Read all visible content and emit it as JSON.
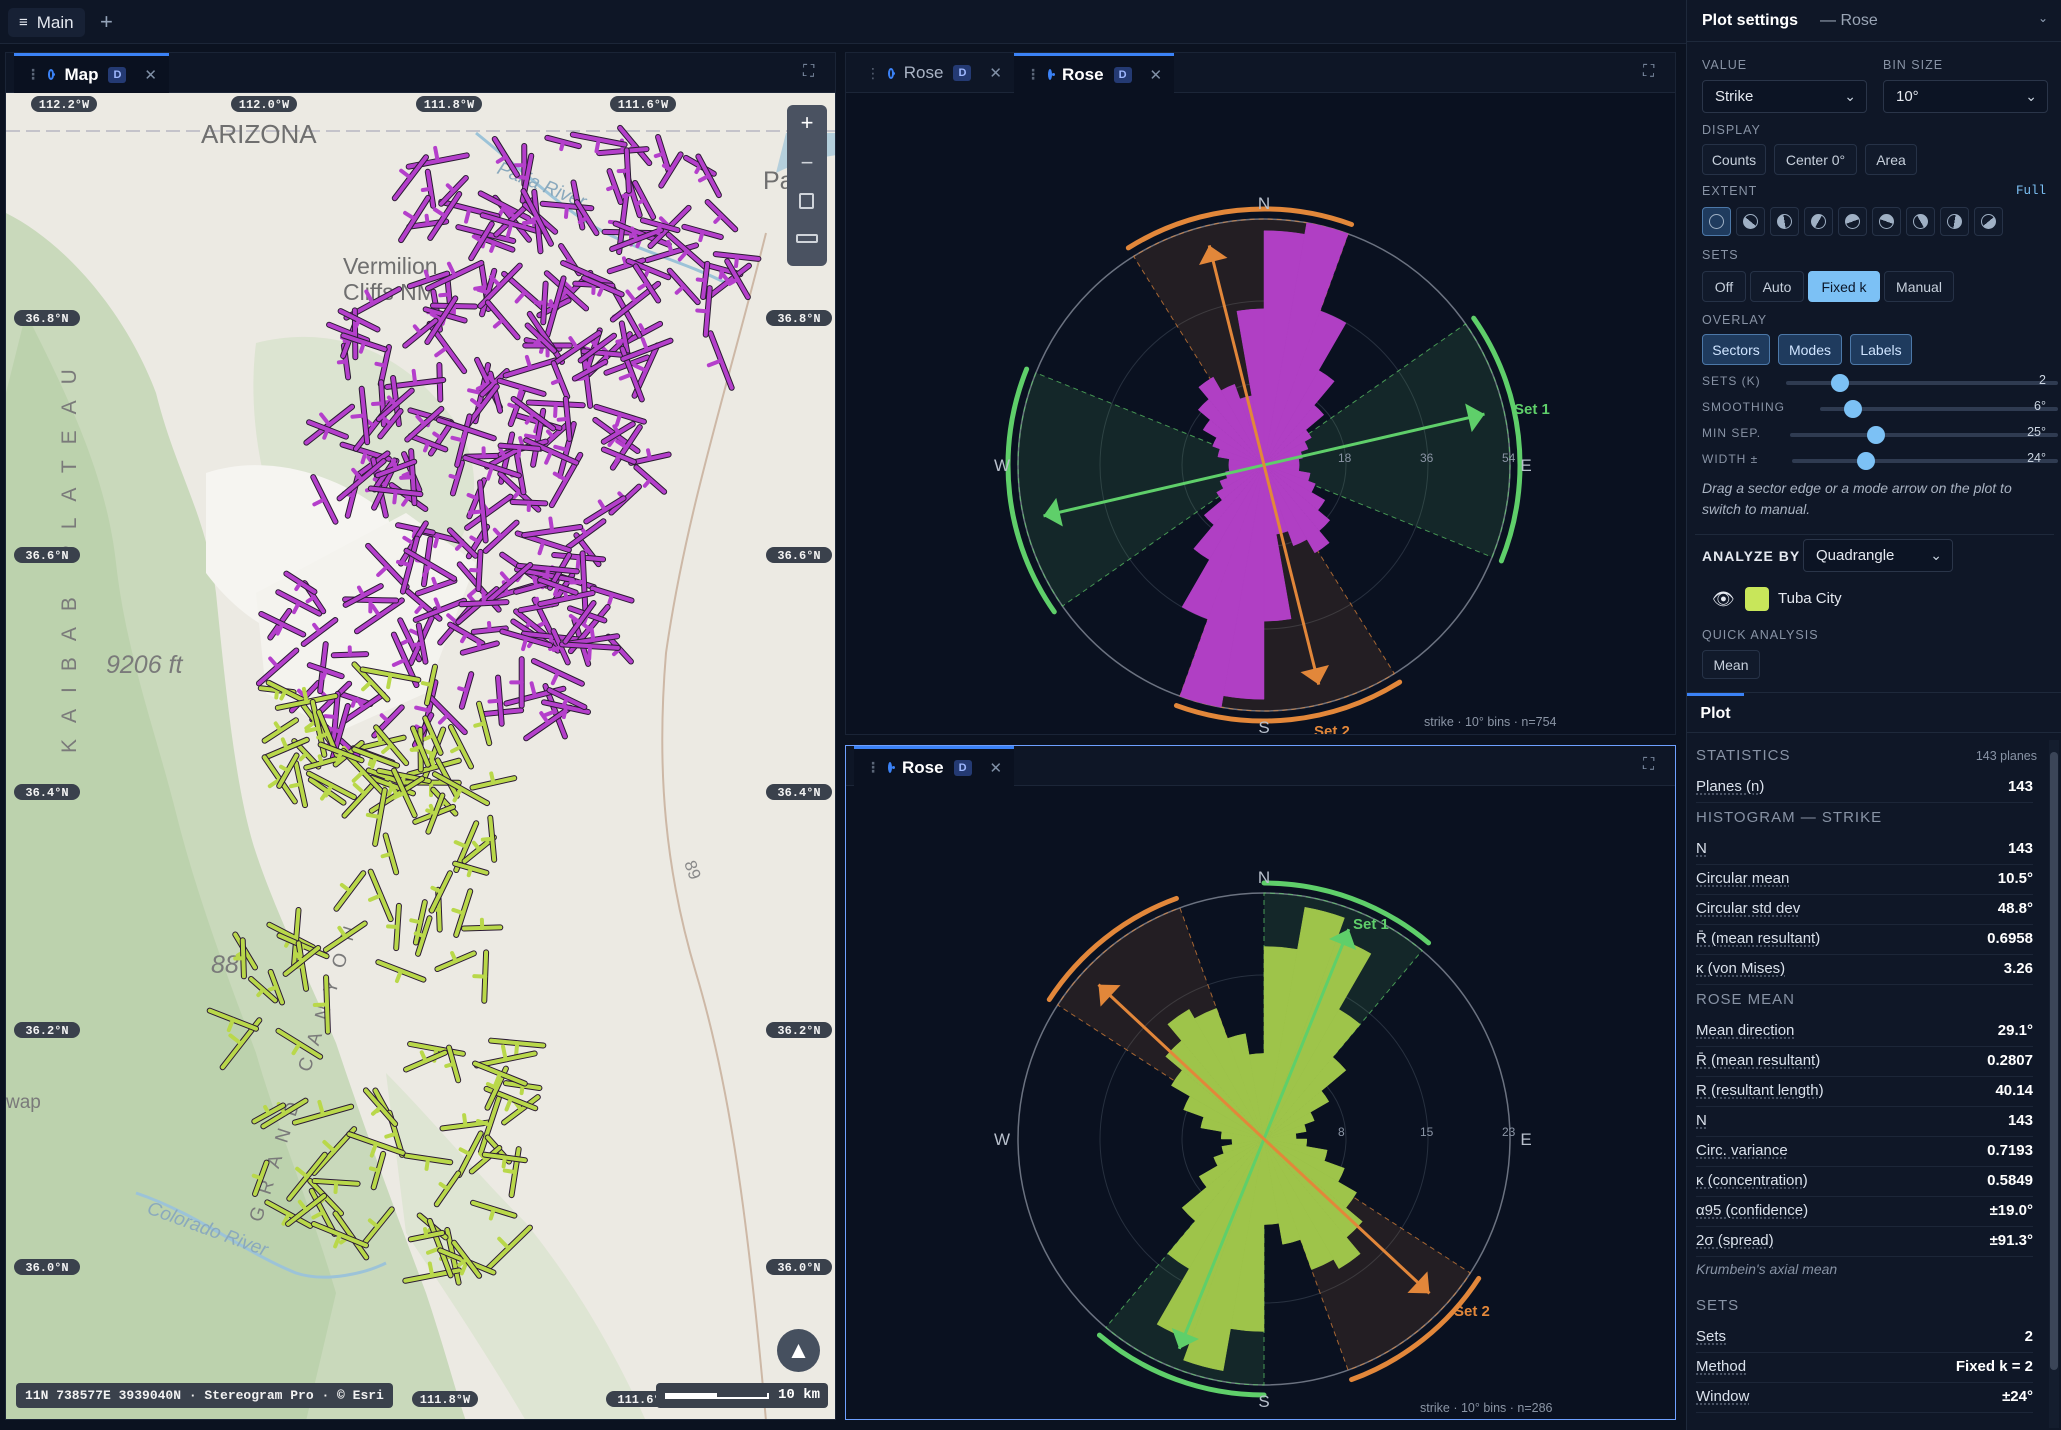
{
  "topbar": {
    "main_tab": "Main",
    "add": "+"
  },
  "map_panel": {
    "tab_label": "Map",
    "badge": "D",
    "state_label": "ARIZONA",
    "monument": [
      "Vermilion",
      "Cliffs NM"
    ],
    "river": "Paria River",
    "colorado": "Colorado River",
    "plateau": "KAIBAB PLATEAU",
    "canyon": "GRAND CANYON",
    "elevation": "9206 ft",
    "elev2": "88",
    "highway": "89",
    "edge_text": "Page",
    "edge_text2": "wap",
    "lon_top": [
      "112.2°W",
      "112.0°W",
      "111.8°W",
      "111.6°W"
    ],
    "lon_bottom": [
      "111.8°W",
      "111.6°"
    ],
    "lat_left": [
      "36.8°N",
      "36.6°N",
      "36.4°N",
      "36.2°N",
      "36.0°N"
    ],
    "lat_right": [
      "36.8°N",
      "36.6°N",
      "36.4°N",
      "36.2°N",
      "36.0°N"
    ],
    "coords_readout": "11N 738577E 3939040N · Stereogram Pro · © Esri",
    "scale_label": "10 km",
    "controls": {
      "zoom_in": "+",
      "zoom_out": "−"
    }
  },
  "rose_top": {
    "tabs": [
      {
        "label": "Rose",
        "badge": "D"
      },
      {
        "label": "Rose",
        "badge": "D"
      }
    ],
    "caption": "strike · 10° bins · n=754",
    "compass": {
      "n": "N",
      "e": "E",
      "s": "S",
      "w": "W"
    },
    "ring_labels": [
      "18",
      "36",
      "54"
    ],
    "set1": "Set 1",
    "set2": "Set 2",
    "colors": {
      "bars": "#b03fc4",
      "set1": "#5fcf6a",
      "set2": "#e2873a"
    }
  },
  "rose_bottom": {
    "tab_label": "Rose",
    "badge": "D",
    "caption": "strike · 10° bins · n=286",
    "compass": {
      "n": "N",
      "e": "E",
      "s": "S",
      "w": "W"
    },
    "ring_labels": [
      "8",
      "15",
      "23"
    ],
    "set1": "Set 1",
    "set2": "Set 2",
    "colors": {
      "bars": "#9ec44a",
      "set1": "#5fcf6a",
      "set2": "#e2873a"
    }
  },
  "settings": {
    "title": "Plot settings",
    "subtitle": "— Rose",
    "value_label": "VALUE",
    "value": "Strike",
    "bin_label": "BIN SIZE",
    "bin": "10°",
    "display_label": "DISPLAY",
    "display_buttons": [
      "Counts",
      "Center 0°",
      "Area"
    ],
    "extent_label": "EXTENT",
    "extent_full": "Full",
    "sets_label": "SETS",
    "sets_buttons": [
      "Off",
      "Auto",
      "Fixed k",
      "Manual"
    ],
    "overlay_label": "OVERLAY",
    "overlay_buttons": [
      "Sectors",
      "Modes",
      "Labels"
    ],
    "sliders": [
      {
        "label": "SETS (K)",
        "value": "2",
        "level": 0.2
      },
      {
        "label": "SMOOTHING",
        "value": "6°",
        "level": 0.14
      },
      {
        "label": "MIN SEP.",
        "value": "25°",
        "level": 0.32
      },
      {
        "label": "WIDTH ±",
        "value": "24°",
        "level": 0.28
      }
    ],
    "hint": "Drag a sector edge or a mode arrow on the plot to switch to manual.",
    "analyze_label": "ANALYZE BY",
    "analyze_value": "Quadrangle",
    "layer_name": "Tuba City",
    "layer_color": "#c8e65a",
    "quick_label": "QUICK ANALYSIS",
    "quick_button": "Mean"
  },
  "plot_tab": "Plot",
  "stats": {
    "statistics_label": "STATISTICS",
    "planes_count": "143 planes",
    "planes": {
      "k": "Planes (n)",
      "v": "143"
    },
    "histogram_label": "HISTOGRAM — STRIKE",
    "histogram": [
      {
        "k": "N",
        "v": "143"
      },
      {
        "k": "Circular mean",
        "v": "10.5°"
      },
      {
        "k": "Circular std dev",
        "v": "48.8°"
      },
      {
        "k": "R̄ (mean resultant)",
        "v": "0.6958"
      },
      {
        "k": "κ (von Mises)",
        "v": "3.26"
      }
    ],
    "rose_mean_label": "ROSE MEAN",
    "rose_mean": [
      {
        "k": "Mean direction",
        "v": "29.1°"
      },
      {
        "k": "R̄ (mean resultant)",
        "v": "0.2807"
      },
      {
        "k": "R (resultant length)",
        "v": "40.14"
      },
      {
        "k": "N",
        "v": "143"
      },
      {
        "k": "Circ. variance",
        "v": "0.7193"
      },
      {
        "k": "κ (concentration)",
        "v": "0.5849"
      },
      {
        "k": "α95 (confidence)",
        "v": "±19.0°"
      },
      {
        "k": "2σ (spread)",
        "v": "±91.3°"
      }
    ],
    "krumbein_note": "Krumbein's axial mean",
    "sets_label": "SETS",
    "sets": [
      {
        "k": "Sets",
        "v": "2"
      },
      {
        "k": "Method",
        "v": "Fixed k = 2"
      },
      {
        "k": "Window",
        "v": "±24°"
      }
    ]
  }
}
